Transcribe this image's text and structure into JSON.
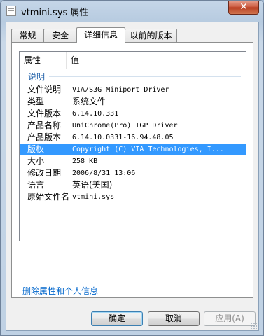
{
  "window": {
    "title": "vtmini.sys 属性",
    "close_symbol": "✕"
  },
  "tabs": [
    {
      "label": "常规"
    },
    {
      "label": "安全"
    },
    {
      "label": "详细信息"
    },
    {
      "label": "以前的版本"
    }
  ],
  "details": {
    "columns": {
      "property": "属性",
      "value": "值"
    },
    "group_label": "说明",
    "rows": [
      {
        "key": "文件说明",
        "value": "VIA/S3G Miniport Driver"
      },
      {
        "key": "类型",
        "value": "系统文件"
      },
      {
        "key": "文件版本",
        "value": "6.14.10.331"
      },
      {
        "key": "产品名称",
        "value": "UniChrome(Pro) IGP Driver"
      },
      {
        "key": "产品版本",
        "value": "6.14.10.0331-16.94.48.05"
      },
      {
        "key": "版权",
        "value": "Copyright (C) VIA Technologies, I..."
      },
      {
        "key": "大小",
        "value": "258 KB"
      },
      {
        "key": "修改日期",
        "value": "2006/8/31 13:06"
      },
      {
        "key": "语言",
        "value": "英语(美国)"
      },
      {
        "key": "原始文件名",
        "value": "vtmini.sys"
      }
    ]
  },
  "remove_link": "删除属性和个人信息",
  "buttons": {
    "ok": "确定",
    "cancel": "取消",
    "apply": "应用(A)"
  }
}
